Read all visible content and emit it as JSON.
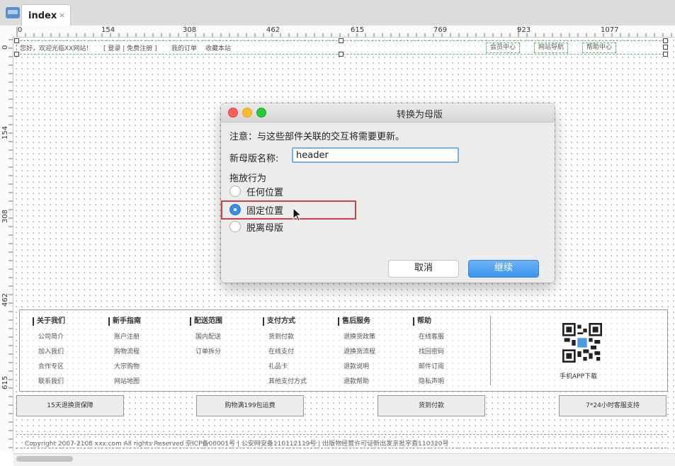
{
  "tab": {
    "label": "index",
    "close": "×"
  },
  "ruler": {
    "h_labels": [
      "0",
      "154",
      "308",
      "462",
      "615",
      "769",
      "923",
      "1077"
    ],
    "v_labels": [
      "0",
      "154",
      "308",
      "462",
      "615"
    ]
  },
  "header": {
    "welcome": "您好，欢迎光临XX网站！",
    "login": "[ 登录 | 免费注册 ]",
    "orders": "我的订单",
    "favorites": "收藏本站",
    "buttons": [
      "会员中心",
      "网站导航",
      "帮助中心"
    ]
  },
  "dialog": {
    "title": "转换为母版",
    "note": "注意：与这些部件关联的交互将需要更新。",
    "name_label": "新母版名称:",
    "name_value": "header",
    "drag_title": "拖放行为",
    "options": [
      "任何位置",
      "固定位置",
      "脱离母版"
    ],
    "selected_option": "固定位置",
    "cancel": "取消",
    "continue": "继续"
  },
  "footer": {
    "columns": [
      {
        "title": "关于我们",
        "items": [
          "公司简介",
          "加入我们",
          "合作专区",
          "联系我们"
        ]
      },
      {
        "title": "新手指南",
        "items": [
          "账户注册",
          "购物流程",
          "大宗购物",
          "网站地图"
        ]
      },
      {
        "title": "配送范围",
        "items": [
          "国内配送",
          "订单拆分"
        ]
      },
      {
        "title": "支付方式",
        "items": [
          "货到付款",
          "在线支付",
          "礼品卡",
          "其他支付方式"
        ]
      },
      {
        "title": "售后服务",
        "items": [
          "退换货政策",
          "退换货流程",
          "退款说明",
          "退款帮助"
        ]
      },
      {
        "title": "帮助",
        "items": [
          "在线客服",
          "找回密码",
          "邮件订阅",
          "隐私声明"
        ]
      }
    ],
    "app_label": "手机APP下载",
    "services": [
      "15天退换货保障",
      "购物满199包运费",
      "货到付款",
      "7*24小时客服支持"
    ],
    "copyright": "Copyright 2007-2108 xxx.com All rights Reserved 京ICP备00001号 | 公安网安备110112119号 | 出版物经营许可证新出发京批字直110320号"
  },
  "colors": {
    "accent": "#3b8ae6",
    "highlight": "#d0424d",
    "widget_border": "#62b878"
  }
}
